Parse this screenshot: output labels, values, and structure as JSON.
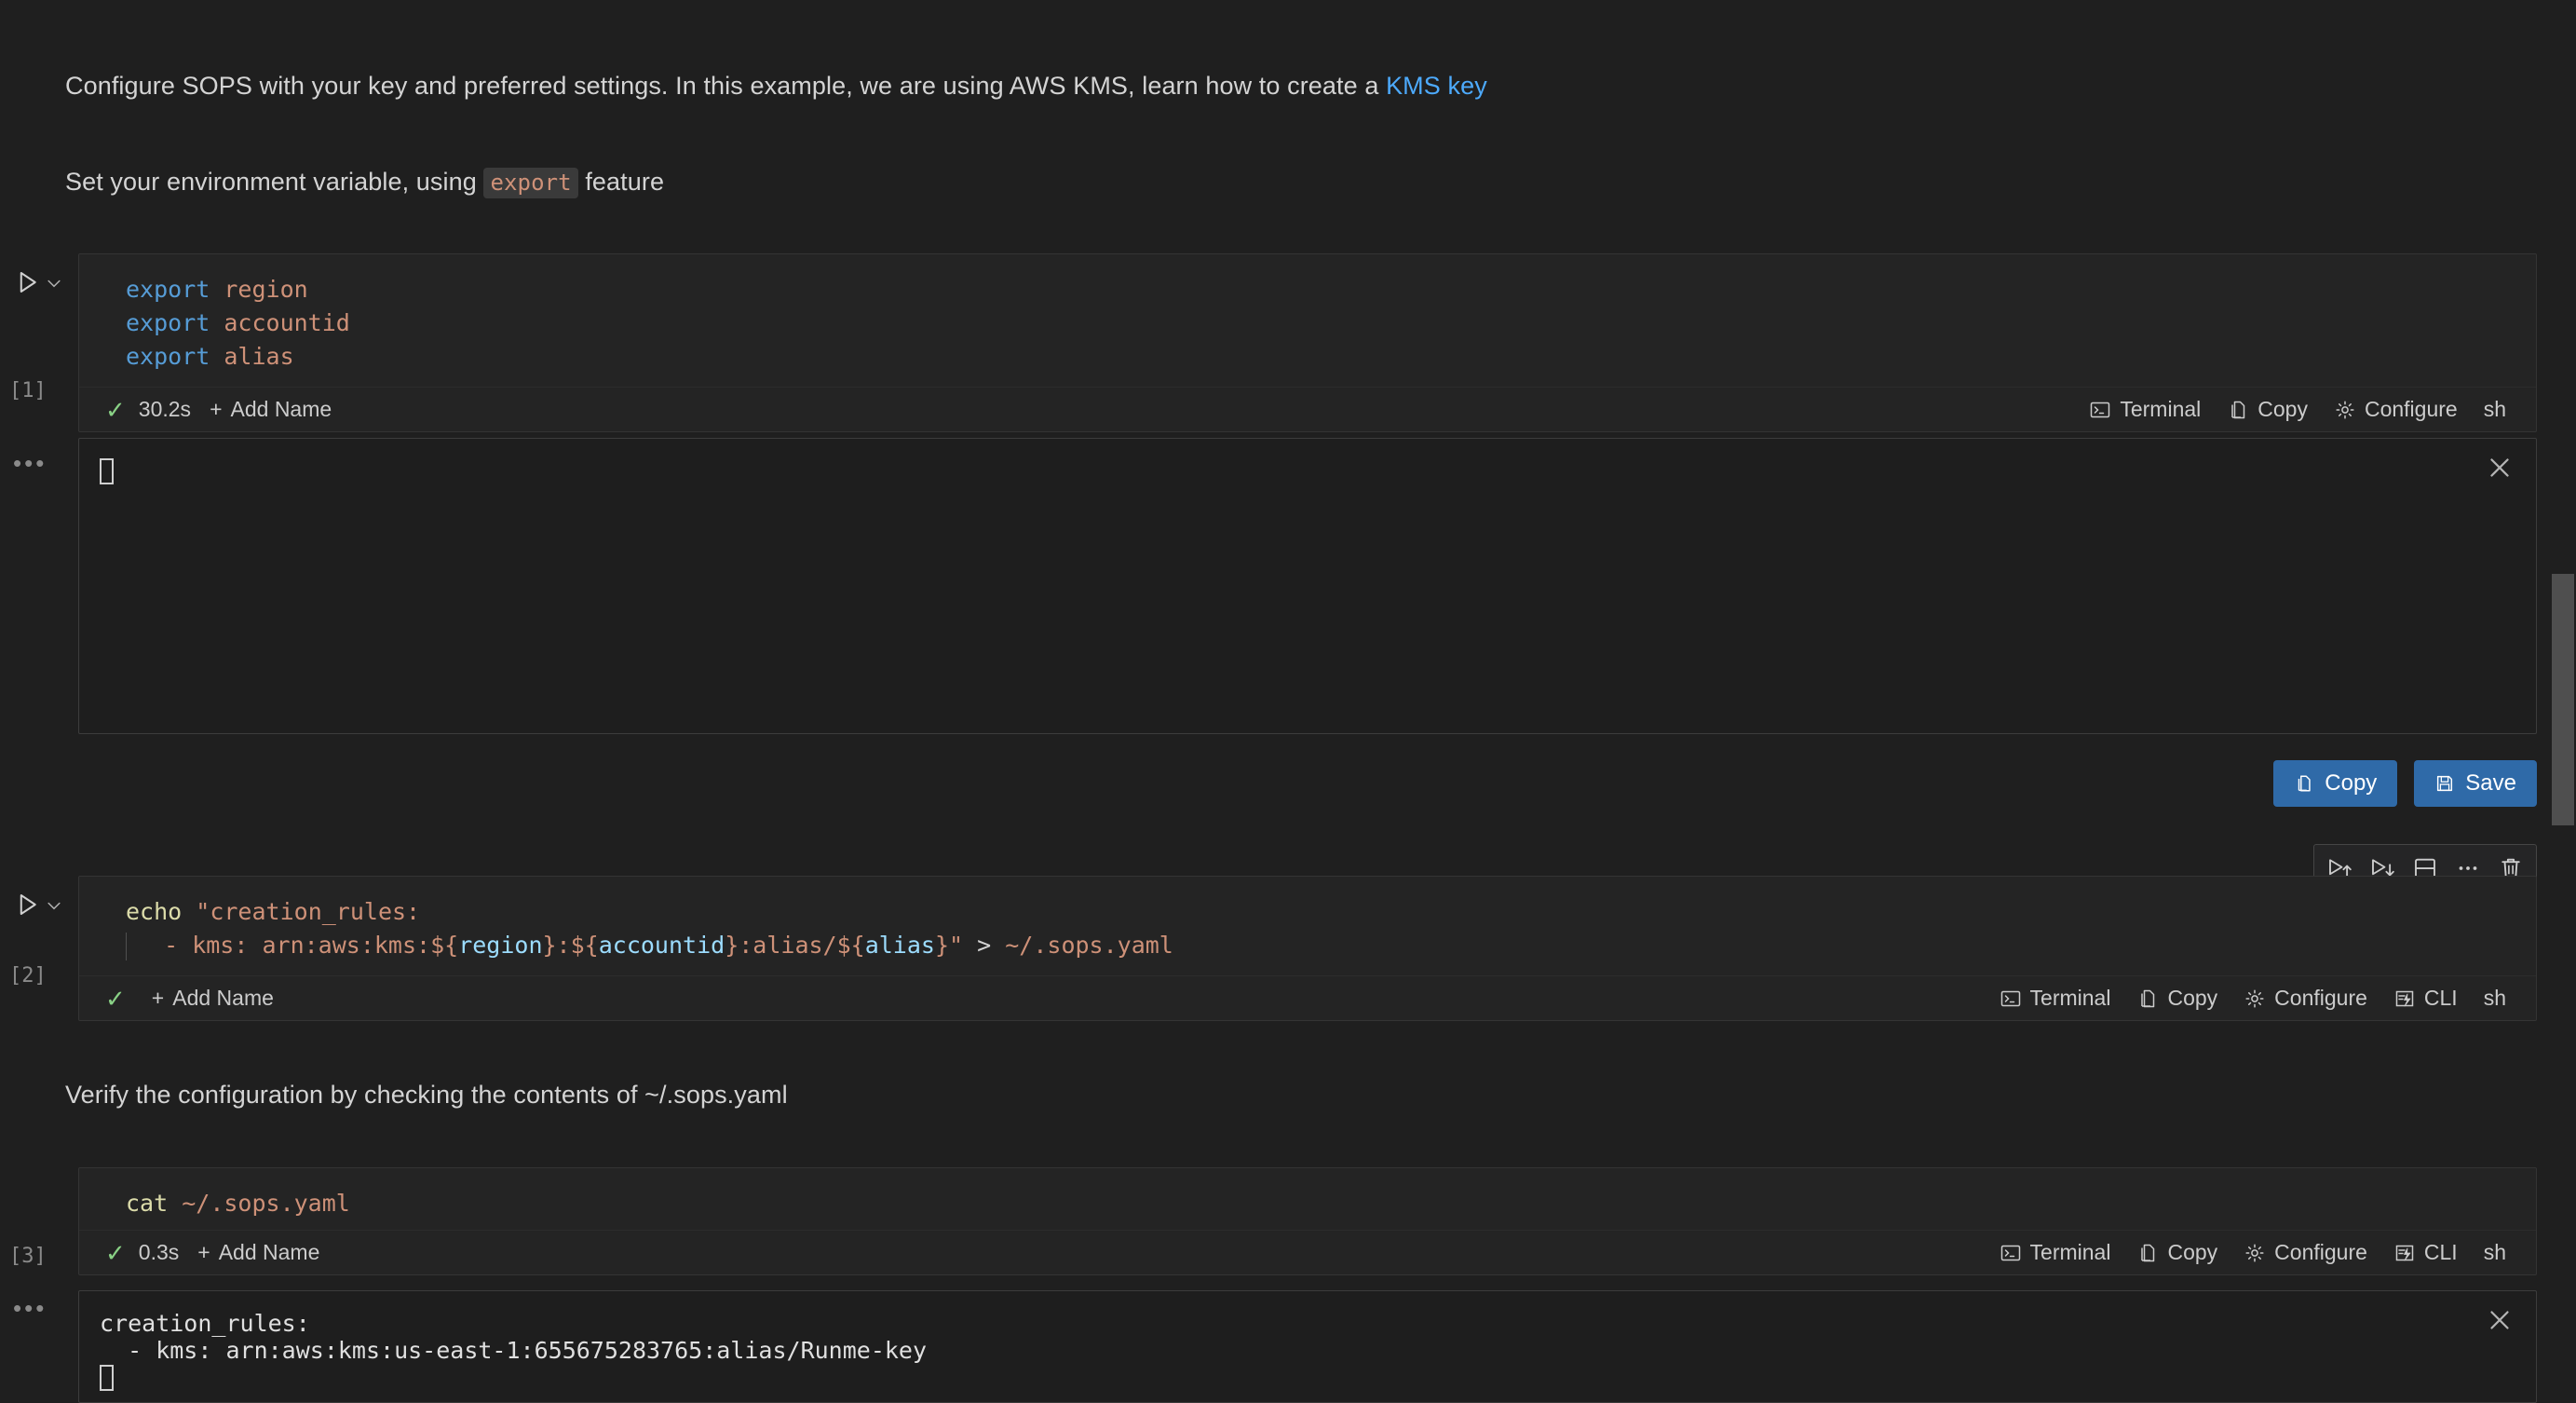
{
  "doc": {
    "paragraphs": [
      {
        "id": "intro",
        "pre": "Configure SOPS with your key and preferred settings. In this example, we are using AWS KMS, learn how to create a ",
        "link": "KMS key"
      },
      {
        "id": "env-var",
        "pre": "Set your environment variable, using ",
        "code": "export",
        "post": " feature"
      },
      {
        "id": "verify",
        "text": "Verify the configuration by checking the contents of ~/.sops.yaml"
      }
    ]
  },
  "cells": [
    {
      "exec_count": "[1]",
      "language": "sh",
      "status": {
        "check": "✓",
        "duration": "30.2s",
        "add_name": "Add Name",
        "plus": "+"
      },
      "actions": [
        {
          "icon": "terminal-icon",
          "label": "Terminal"
        },
        {
          "icon": "copy-icon",
          "label": "Copy"
        },
        {
          "icon": "gear-icon",
          "label": "Configure"
        }
      ],
      "code_lines": [
        [
          {
            "t": "export",
            "c": "kw"
          },
          {
            "t": " ",
            "c": "op"
          },
          {
            "t": "region",
            "c": "ident"
          }
        ],
        [
          {
            "t": "export",
            "c": "kw"
          },
          {
            "t": " ",
            "c": "op"
          },
          {
            "t": "accountid",
            "c": "ident"
          }
        ],
        [
          {
            "t": "export",
            "c": "kw"
          },
          {
            "t": " ",
            "c": "op"
          },
          {
            "t": "alias",
            "c": "ident"
          }
        ]
      ],
      "output": {
        "lines": [
          ""
        ],
        "cursor": true,
        "close_label": "×",
        "buttons": [
          {
            "icon": "copy-icon",
            "label": "Copy"
          },
          {
            "icon": "save-icon",
            "label": "Save"
          }
        ]
      }
    },
    {
      "exec_count": "[2]",
      "language": "sh",
      "status": {
        "check": "✓",
        "duration": "",
        "add_name": "Add Name",
        "plus": "+"
      },
      "actions": [
        {
          "icon": "terminal-icon",
          "label": "Terminal"
        },
        {
          "icon": "copy-icon",
          "label": "Copy"
        },
        {
          "icon": "gear-icon",
          "label": "Configure"
        },
        {
          "icon": "cli-icon",
          "label": "CLI"
        }
      ],
      "code_lines": [
        [
          {
            "t": "echo",
            "c": "fn"
          },
          {
            "t": " ",
            "c": "op"
          },
          {
            "t": "\"creation_rules:",
            "c": "str"
          }
        ],
        [
          {
            "t": "  - kms: arn:aws:kms:${",
            "c": "str",
            "guide": true
          },
          {
            "t": "region",
            "c": "var"
          },
          {
            "t": "}:${",
            "c": "str"
          },
          {
            "t": "accountid",
            "c": "var"
          },
          {
            "t": "}:alias/${",
            "c": "str"
          },
          {
            "t": "alias",
            "c": "var"
          },
          {
            "t": "}\"",
            "c": "str"
          },
          {
            "t": " > ",
            "c": "op"
          },
          {
            "t": "~/.sops.yaml",
            "c": "ident"
          }
        ]
      ],
      "hover_toolbar": [
        {
          "icon": "run-above-icon",
          "label": "Run Above"
        },
        {
          "icon": "run-below-icon",
          "label": "Run Below"
        },
        {
          "icon": "split-cell-icon",
          "label": "Split Cell"
        },
        {
          "icon": "more-icon",
          "label": "More Actions"
        },
        {
          "icon": "trash-icon",
          "label": "Delete Cell"
        }
      ]
    },
    {
      "exec_count": "[3]",
      "language": "sh",
      "status": {
        "check": "✓",
        "duration": "0.3s",
        "add_name": "Add Name",
        "plus": "+"
      },
      "actions": [
        {
          "icon": "terminal-icon",
          "label": "Terminal"
        },
        {
          "icon": "copy-icon",
          "label": "Copy"
        },
        {
          "icon": "gear-icon",
          "label": "Configure"
        },
        {
          "icon": "cli-icon",
          "label": "CLI"
        }
      ],
      "code_lines": [
        [
          {
            "t": "cat",
            "c": "fn"
          },
          {
            "t": " ",
            "c": "op"
          },
          {
            "t": "~/.sops.yaml",
            "c": "ident"
          }
        ]
      ],
      "output": {
        "lines": [
          "creation_rules:",
          "  - kms: arn:aws:kms:us-east-1:655675283765:alias/Runme-key"
        ],
        "cursor": true,
        "close_label": "×"
      }
    }
  ],
  "colors": {
    "background": "#1f1f1f",
    "editor_background": "#242424",
    "accent_blue": "#2f6aa8",
    "link_blue": "#4daafc",
    "success_green": "#89d185",
    "scrollbar_thumb": "#4f4f4f"
  }
}
